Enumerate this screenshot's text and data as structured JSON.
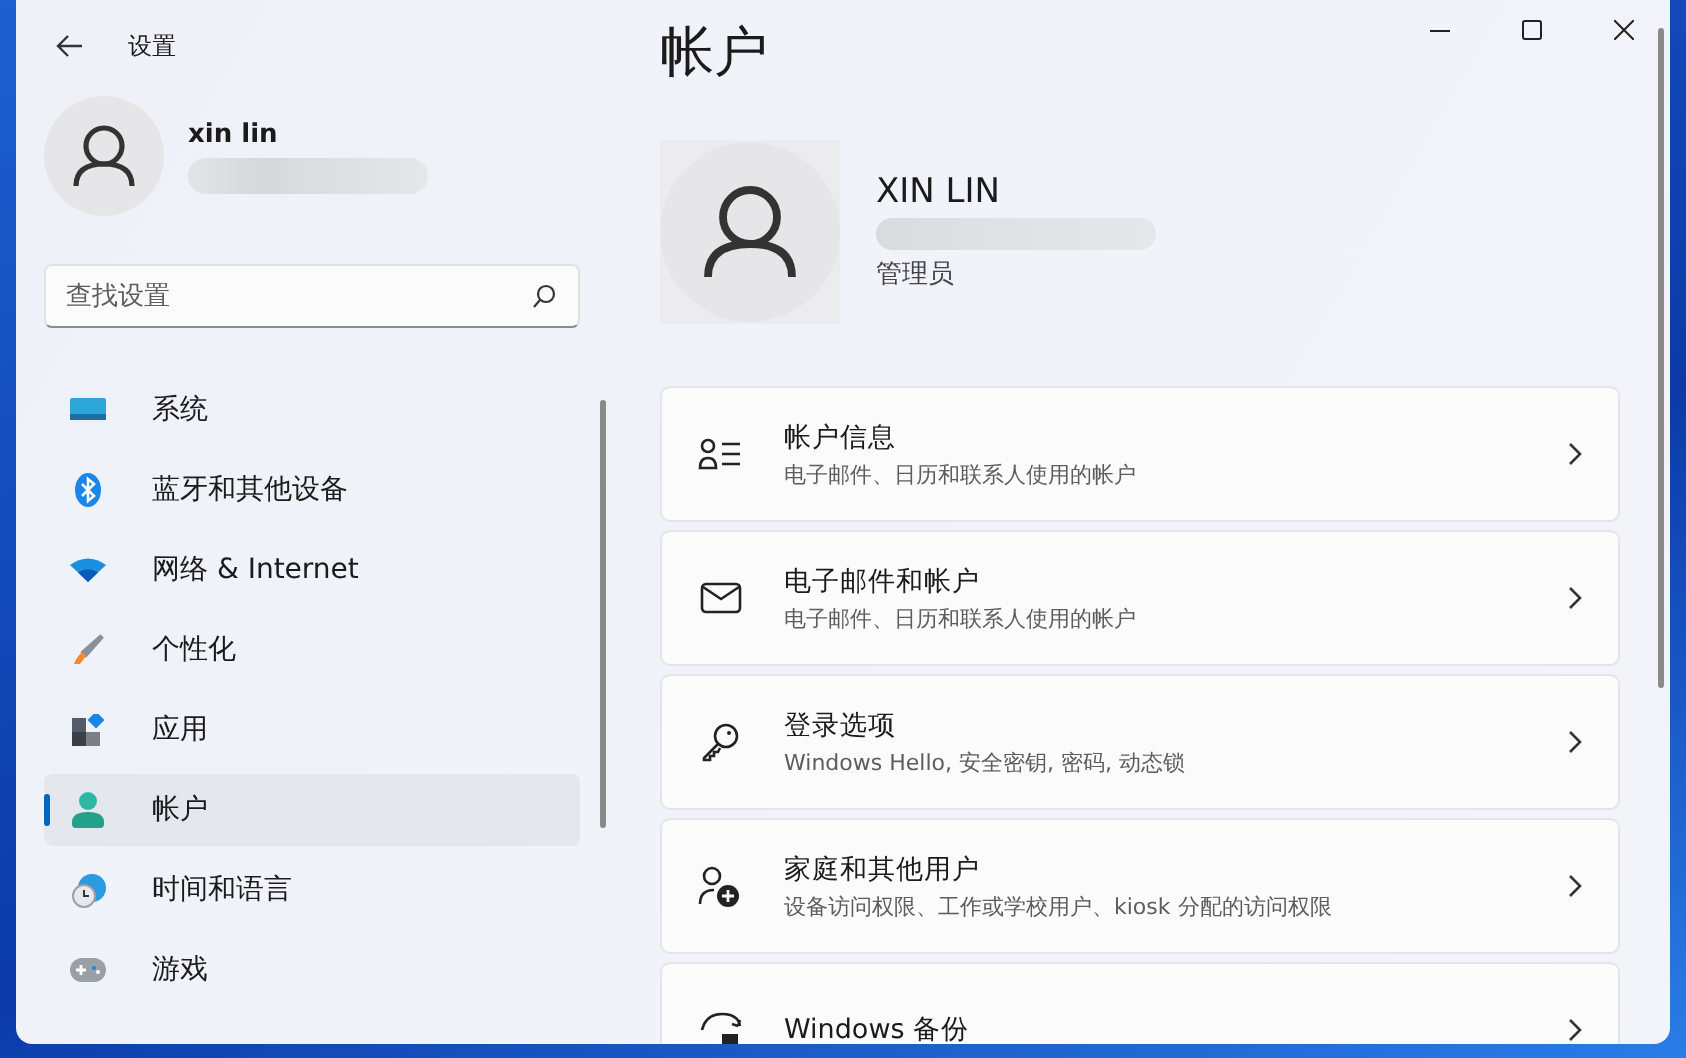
{
  "window": {
    "title": "设置"
  },
  "profile": {
    "name": "xin lin"
  },
  "search": {
    "placeholder": "查找设置"
  },
  "nav": [
    {
      "label": "系统",
      "selected": false
    },
    {
      "label": "蓝牙和其他设备",
      "selected": false
    },
    {
      "label": "网络 & Internet",
      "selected": false
    },
    {
      "label": "个性化",
      "selected": false
    },
    {
      "label": "应用",
      "selected": false
    },
    {
      "label": "帐户",
      "selected": true
    },
    {
      "label": "时间和语言",
      "selected": false
    },
    {
      "label": "游戏",
      "selected": false
    }
  ],
  "page": {
    "title": "帐户",
    "user_name": "XIN LIN",
    "role": "管理员"
  },
  "cards": [
    {
      "title": "帐户信息",
      "subtitle": "电子邮件、日历和联系人使用的帐户"
    },
    {
      "title": "电子邮件和帐户",
      "subtitle": "电子邮件、日历和联系人使用的帐户"
    },
    {
      "title": "登录选项",
      "subtitle": "Windows Hello, 安全密钥, 密码, 动态锁"
    },
    {
      "title": "家庭和其他用户",
      "subtitle": "设备访问权限、工作或学校用户、kiosk 分配的访问权限"
    },
    {
      "title": "Windows 备份"
    }
  ]
}
